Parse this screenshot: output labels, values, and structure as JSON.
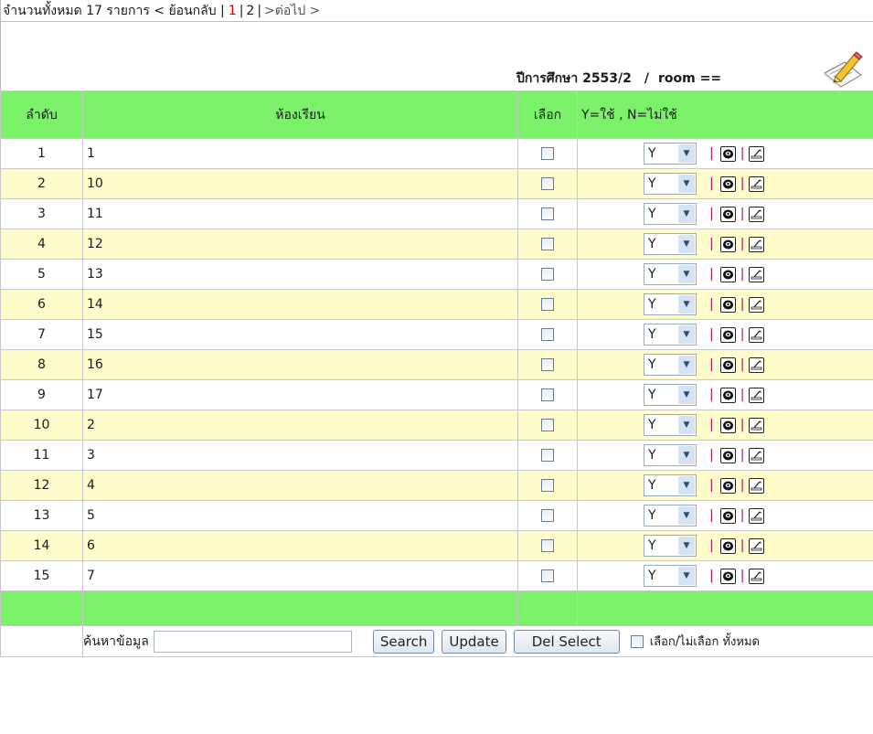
{
  "pager": {
    "total_text": "จำนวนทั้งหมด 17 รายการ < ย้อนกลับ |",
    "page1": "1",
    "sep1": "|",
    "page2": "2",
    "sep2": "|",
    "next": ">ต่อไป >"
  },
  "header": {
    "year_label": "ปีการศึกษา 2553/2",
    "slash": "/",
    "room_label": "room ==",
    "edit_icon": "pencil-paper-icon"
  },
  "table": {
    "columns": {
      "no": "ลำดับ",
      "room": "ห้องเรียน",
      "select": "เลือก",
      "status": "Y=ใช้ , N=ไม่ใช้"
    },
    "rows": [
      {
        "no": "1",
        "room": "1",
        "status": "Y"
      },
      {
        "no": "2",
        "room": "10",
        "status": "Y"
      },
      {
        "no": "3",
        "room": "11",
        "status": "Y"
      },
      {
        "no": "4",
        "room": "12",
        "status": "Y"
      },
      {
        "no": "5",
        "room": "13",
        "status": "Y"
      },
      {
        "no": "6",
        "room": "14",
        "status": "Y"
      },
      {
        "no": "7",
        "room": "15",
        "status": "Y"
      },
      {
        "no": "8",
        "room": "16",
        "status": "Y"
      },
      {
        "no": "9",
        "room": "17",
        "status": "Y"
      },
      {
        "no": "10",
        "room": "2",
        "status": "Y"
      },
      {
        "no": "11",
        "room": "3",
        "status": "Y"
      },
      {
        "no": "12",
        "room": "4",
        "status": "Y"
      },
      {
        "no": "13",
        "room": "5",
        "status": "Y"
      },
      {
        "no": "14",
        "room": "6",
        "status": "Y"
      },
      {
        "no": "15",
        "room": "7",
        "status": "Y"
      }
    ],
    "pipe": "|"
  },
  "search": {
    "label": "ค้นหาข้อมูล",
    "value": "",
    "search_button": "Search",
    "update_button": "Update",
    "del_button": "Del Select",
    "select_all_label": "เลือก/ไม่เลือก ทั้งหมด"
  },
  "colors": {
    "header_bg": "#7cf26a",
    "odd_row": "#ffffff",
    "even_row": "#fffccc",
    "pipe": "#b01060",
    "current_page": "#d40000"
  }
}
